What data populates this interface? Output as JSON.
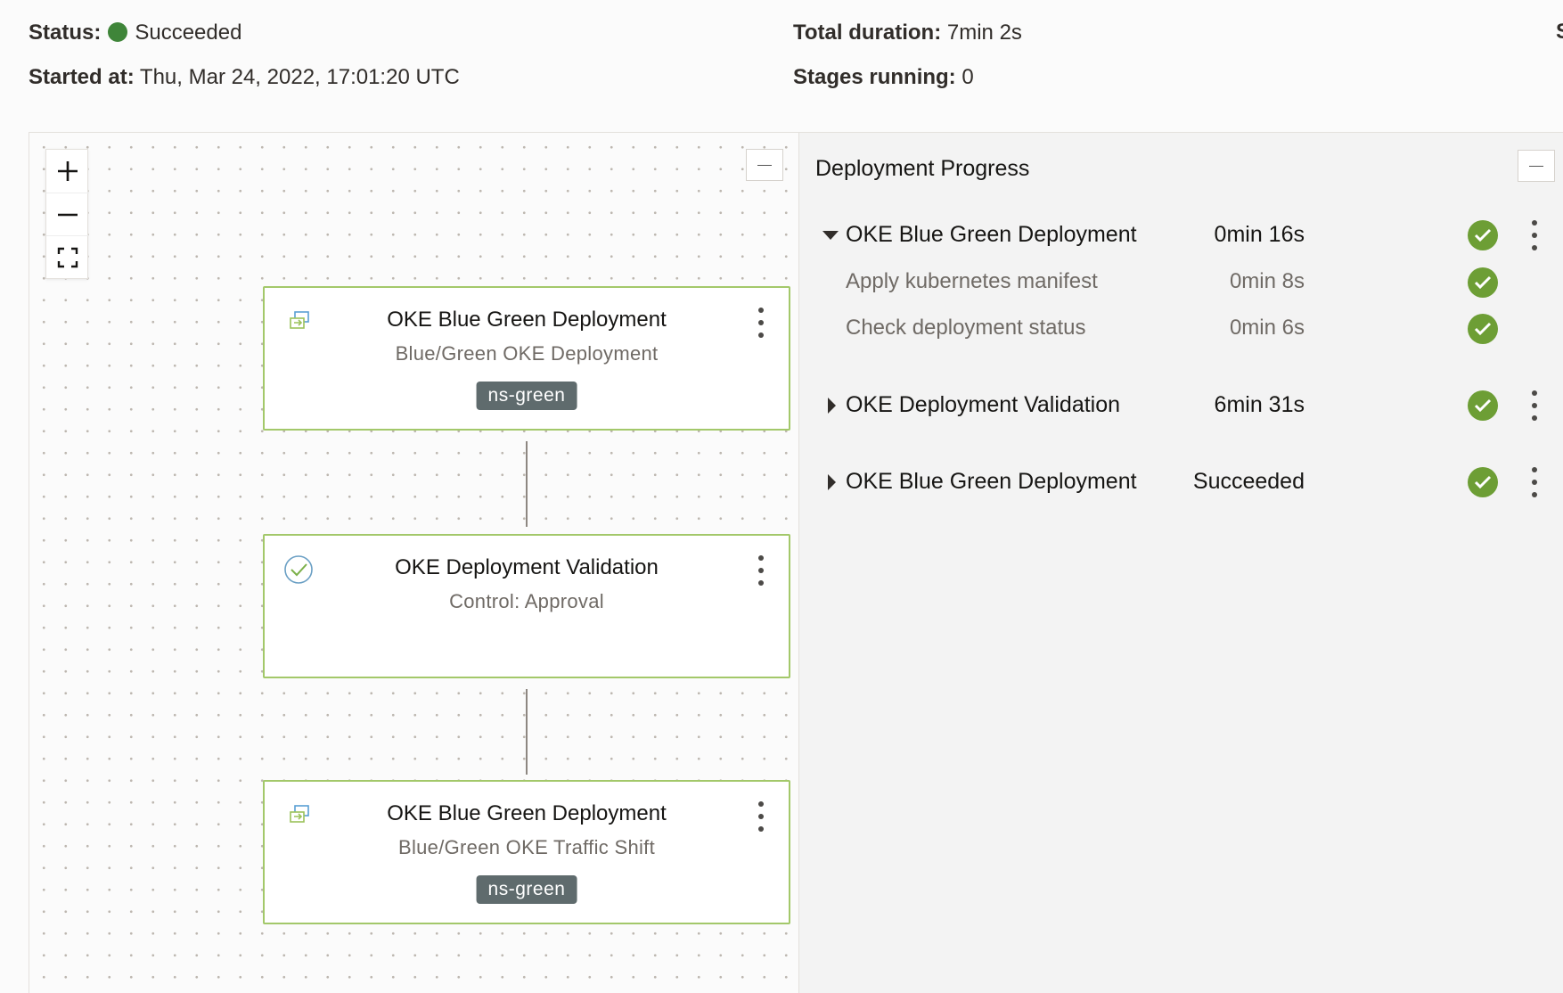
{
  "header": {
    "status_label": "Status:",
    "status_value": "Succeeded",
    "status_color": "#3f8539",
    "started_label": "Started at:",
    "started_value": "Thu, Mar 24, 2022, 17:01:20 UTC",
    "duration_label": "Total duration:",
    "duration_value": "7min 2s",
    "stages_label": "Stages running:",
    "stages_value": "0",
    "clipped_glyph": "S"
  },
  "canvas": {
    "zoom_controls": [
      "zoom-in-icon",
      "zoom-out-icon",
      "fit-to-screen-icon"
    ],
    "cards": [
      {
        "icon": "deploy-swap-icon",
        "title": "OKE Blue Green Deployment",
        "subtitle": "Blue/Green OKE Deployment",
        "badge": "ns-green"
      },
      {
        "icon": "approval-check-icon",
        "title": "OKE Deployment Validation",
        "subtitle": "Control: Approval",
        "badge": ""
      },
      {
        "icon": "deploy-swap-icon",
        "title": "OKE Blue Green Deployment",
        "subtitle": "Blue/Green OKE Traffic Shift",
        "badge": "ns-green"
      }
    ],
    "card_border_color": "#a3c86a"
  },
  "progress": {
    "title": "Deployment Progress",
    "rows": [
      {
        "label": "OKE Blue Green Deployment",
        "value": "0min 16s",
        "expanded": true
      },
      {
        "label": "Apply kubernetes manifest",
        "value": "0min 8s",
        "sub": true
      },
      {
        "label": "Check deployment status",
        "value": "0min 6s",
        "sub": true
      },
      {
        "label": "OKE Deployment Validation",
        "value": "6min 31s",
        "expanded": false
      },
      {
        "label": "OKE Blue Green Deployment",
        "value": "Succeeded",
        "expanded": false
      }
    ],
    "success_color": "#6d9e35"
  }
}
